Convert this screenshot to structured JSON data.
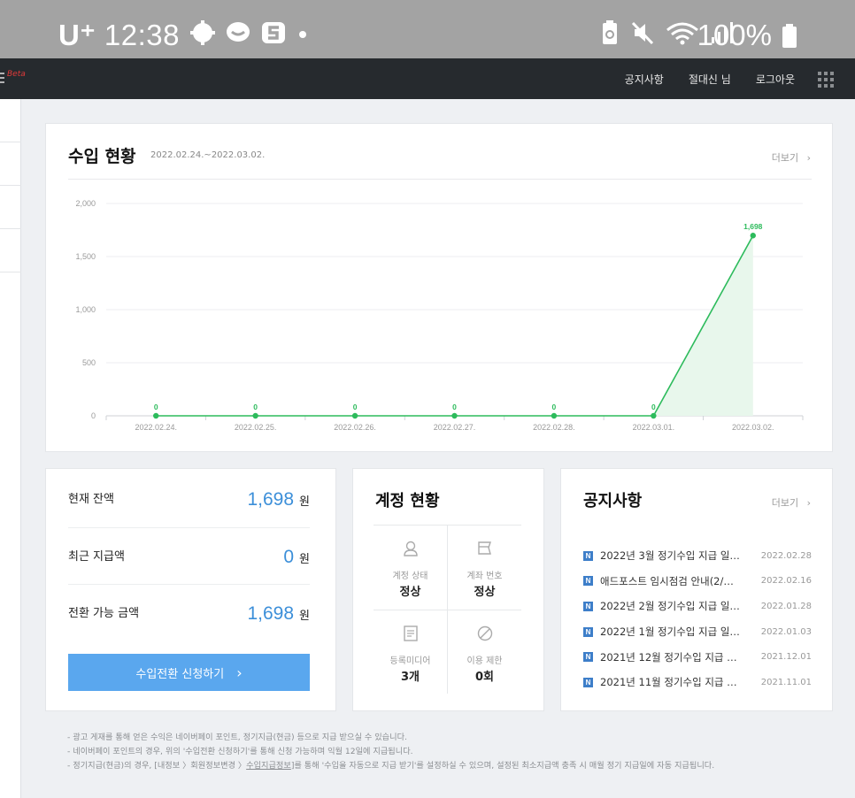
{
  "status_bar": {
    "carrier": "U⁺",
    "time": "12:38",
    "battery": "100%"
  },
  "topnav": {
    "logo_fragment": "Beta",
    "links": [
      "공지사항",
      "절대신 님",
      "로그아웃"
    ]
  },
  "revenue": {
    "title": "수입 현황",
    "date_range": "2022.02.24.~2022.03.02.",
    "more": "더보기",
    "chart_data": {
      "type": "line",
      "categories": [
        "2022.02.24.",
        "2022.02.25.",
        "2022.02.26.",
        "2022.02.27.",
        "2022.02.28.",
        "2022.03.01.",
        "2022.03.02."
      ],
      "values": [
        0,
        0,
        0,
        0,
        0,
        0,
        1698
      ],
      "data_labels": [
        "0",
        "0",
        "0",
        "0",
        "0",
        "0",
        "1,698"
      ],
      "y_ticks": [
        "0",
        "500",
        "1,000",
        "1,500",
        "2,000"
      ],
      "ylim": [
        0,
        2000
      ],
      "grid": true,
      "color": "#2dbb5c"
    }
  },
  "balance": {
    "rows": [
      {
        "label": "현재 잔액",
        "value": "1,698",
        "unit": "원"
      },
      {
        "label": "최근 지급액",
        "value": "0",
        "unit": "원"
      },
      {
        "label": "전환 가능 금액",
        "value": "1,698",
        "unit": "원"
      }
    ],
    "apply_button": "수입전환 신청하기",
    "apply_chevron": "›"
  },
  "account": {
    "title": "계정 현황",
    "cells": [
      {
        "icon": "user-icon",
        "label": "계정 상태",
        "value": "정상"
      },
      {
        "icon": "bank-card-icon",
        "label": "계좌 번호",
        "value": "정상"
      },
      {
        "icon": "document-icon",
        "label": "등록미디어",
        "value": "3개"
      },
      {
        "icon": "ban-icon",
        "label": "이용 제한",
        "value": "0회"
      }
    ]
  },
  "notices": {
    "title": "공지사항",
    "more": "더보기",
    "badge": "N",
    "items": [
      {
        "text": "2022년 3월 정기수입 지급 일…",
        "date": "2022.02.28"
      },
      {
        "text": "애드포스트 임시점검 안내(2/…",
        "date": "2022.02.16"
      },
      {
        "text": "2022년 2월 정기수입 지급 일…",
        "date": "2022.01.28"
      },
      {
        "text": "2022년 1월 정기수입 지급 일…",
        "date": "2022.01.03"
      },
      {
        "text": "2021년 12월 정기수입 지급 …",
        "date": "2021.12.01"
      },
      {
        "text": "2021년 11월 정기수입 지급 …",
        "date": "2021.11.01"
      }
    ]
  },
  "footnotes": {
    "line1": "- 광고 게재를 통해 얻은 수익은 네이버페이 포인트, 정기지급(현금) 등으로 지급 받으실 수 있습니다.",
    "line2": "- 네이버페이 포인트의 경우, 위의 '수입전환 신청하기'를 통해 신청 가능하며 익월 12일에 지급됩니다.",
    "line3_pre": "- 정기지급(현금)의 경우, [내정보 〉회원정보변경 〉",
    "line3_link": "수입지급정보",
    "line3_post": "]를 통해 '수입을 자동으로 지급 받기'를 설정하실 수 있으며, 설정된 최소지급액 충족 시 매월 정기 지급일에 자동 지급됩니다."
  }
}
